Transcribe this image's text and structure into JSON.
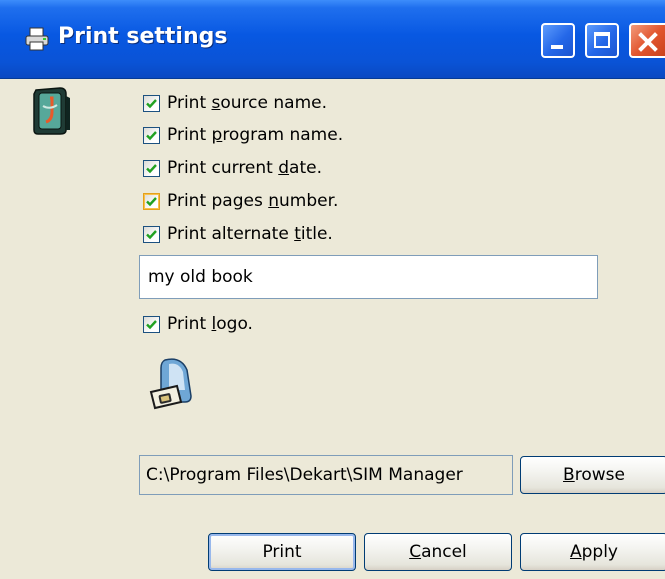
{
  "window": {
    "title": "Print settings",
    "icons": {
      "title": "printer-icon",
      "app": "sim-manager-icon",
      "logo": "sim-card-logo-icon"
    },
    "controls": [
      "minimize-icon",
      "maximize-icon",
      "close-icon"
    ]
  },
  "options": [
    {
      "pre": "Print ",
      "key": "s",
      "post": "ource name.",
      "checked": true
    },
    {
      "pre": "Print ",
      "key": "p",
      "post": "rogram name.",
      "checked": true
    },
    {
      "pre": "Print current ",
      "key": "d",
      "post": "ate.",
      "checked": true
    },
    {
      "pre": "Print pages ",
      "key": "n",
      "post": "umber.",
      "checked": true,
      "highlighted": true
    },
    {
      "pre": "Print alternate ",
      "key": "t",
      "post": "itle.",
      "checked": true
    }
  ],
  "alternate_title": {
    "value": "my old book"
  },
  "logo_option": {
    "pre": "Print ",
    "key": "l",
    "post": "ogo.",
    "checked": true
  },
  "logo_path": "C:\\Program Files\\Dekart\\SIM Manager",
  "buttons": {
    "browse": {
      "key": "B",
      "rest": "rowse"
    },
    "print": "Print",
    "cancel": {
      "key": "C",
      "rest": "ancel"
    },
    "apply": {
      "key": "A",
      "rest": "pply"
    }
  },
  "colors": {
    "titlebar": "#0a53d6",
    "check": "#21a121",
    "dialog": "#ece9d8"
  }
}
